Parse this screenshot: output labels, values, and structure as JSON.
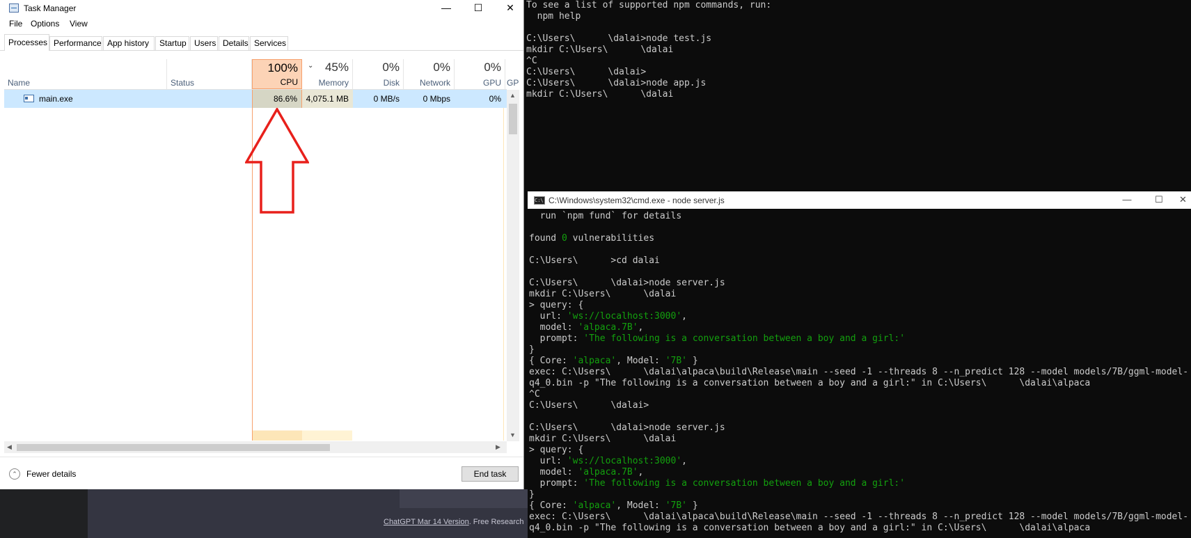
{
  "task_manager": {
    "title": "Task Manager",
    "window_buttons": {
      "minimize": "—",
      "maximize": "☐",
      "close": "✕"
    },
    "menu": [
      "File",
      "Options",
      "View"
    ],
    "tabs": [
      "Processes",
      "Performance",
      "App history",
      "Startup",
      "Users",
      "Details",
      "Services"
    ],
    "active_tab": "Processes",
    "columns": {
      "name": {
        "label": "Name"
      },
      "status": {
        "label": "Status"
      },
      "cpu": {
        "label": "CPU",
        "total": "100%"
      },
      "memory": {
        "label": "Memory",
        "total": "45%"
      },
      "disk": {
        "label": "Disk",
        "total": "0%"
      },
      "network": {
        "label": "Network",
        "total": "0%"
      },
      "gpu": {
        "label": "GPU",
        "total": "0%"
      },
      "gpu_engine": {
        "label": "GPU"
      }
    },
    "row": {
      "name": "main.exe",
      "status": "",
      "cpu": "86.6%",
      "memory": "4,075.1 MB",
      "disk": "0 MB/s",
      "network": "0 Mbps",
      "gpu": "0%"
    },
    "footer": {
      "fewer_details": "Fewer details",
      "end_task": "End task"
    }
  },
  "background_console": {
    "lines": [
      "To see a list of supported npm commands, run:",
      "  npm help",
      "",
      "C:\\Users\\      \\dalai>node test.js",
      "mkdir C:\\Users\\      \\dalai",
      "^C",
      "C:\\Users\\      \\dalai>",
      "C:\\Users\\      \\dalai>node app.js",
      "mkdir C:\\Users\\      \\dalai"
    ]
  },
  "cmd_window": {
    "title": "C:\\Windows\\system32\\cmd.exe - node  server.js",
    "window_buttons": {
      "minimize": "—",
      "maximize": "☐",
      "close": "✕"
    },
    "lines": [
      {
        "segments": [
          {
            "t": "  run `npm fund` for details"
          }
        ]
      },
      {
        "segments": [
          {
            "t": ""
          }
        ]
      },
      {
        "segments": [
          {
            "t": "found "
          },
          {
            "t": "0",
            "c": "g"
          },
          {
            "t": " vulnerabilities"
          }
        ]
      },
      {
        "segments": [
          {
            "t": ""
          }
        ]
      },
      {
        "segments": [
          {
            "t": "C:\\Users\\      >cd dalai"
          }
        ]
      },
      {
        "segments": [
          {
            "t": ""
          }
        ]
      },
      {
        "segments": [
          {
            "t": "C:\\Users\\      \\dalai>node server.js"
          }
        ]
      },
      {
        "segments": [
          {
            "t": "mkdir C:\\Users\\      \\dalai"
          }
        ]
      },
      {
        "segments": [
          {
            "t": "> query: {"
          }
        ]
      },
      {
        "segments": [
          {
            "t": "  url: "
          },
          {
            "t": "'ws://localhost:3000'",
            "c": "g"
          },
          {
            "t": ","
          }
        ]
      },
      {
        "segments": [
          {
            "t": "  model: "
          },
          {
            "t": "'alpaca.7B'",
            "c": "g"
          },
          {
            "t": ","
          }
        ]
      },
      {
        "segments": [
          {
            "t": "  prompt: "
          },
          {
            "t": "'The following is a conversation between a boy and a girl:'",
            "c": "g"
          }
        ]
      },
      {
        "segments": [
          {
            "t": "}"
          }
        ]
      },
      {
        "segments": [
          {
            "t": "{ Core: "
          },
          {
            "t": "'alpaca'",
            "c": "g"
          },
          {
            "t": ", Model: "
          },
          {
            "t": "'7B'",
            "c": "g"
          },
          {
            "t": " }"
          }
        ]
      },
      {
        "segments": [
          {
            "t": "exec: C:\\Users\\      \\dalai\\alpaca\\build\\Release\\main --seed -1 --threads 8 --n_predict 128 --model models/7B/ggml-model-"
          }
        ]
      },
      {
        "segments": [
          {
            "t": "q4_0.bin -p \"The following is a conversation between a boy and a girl:\" in C:\\Users\\      \\dalai\\alpaca"
          }
        ]
      },
      {
        "segments": [
          {
            "t": "^C"
          }
        ]
      },
      {
        "segments": [
          {
            "t": "C:\\Users\\      \\dalai>"
          }
        ]
      },
      {
        "segments": [
          {
            "t": ""
          }
        ]
      },
      {
        "segments": [
          {
            "t": "C:\\Users\\      \\dalai>node server.js"
          }
        ]
      },
      {
        "segments": [
          {
            "t": "mkdir C:\\Users\\      \\dalai"
          }
        ]
      },
      {
        "segments": [
          {
            "t": "> query: {"
          }
        ]
      },
      {
        "segments": [
          {
            "t": "  url: "
          },
          {
            "t": "'ws://localhost:3000'",
            "c": "g"
          },
          {
            "t": ","
          }
        ]
      },
      {
        "segments": [
          {
            "t": "  model: "
          },
          {
            "t": "'alpaca.7B'",
            "c": "g"
          },
          {
            "t": ","
          }
        ]
      },
      {
        "segments": [
          {
            "t": "  prompt: "
          },
          {
            "t": "'The following is a conversation between a boy and a girl:'",
            "c": "g"
          }
        ]
      },
      {
        "segments": [
          {
            "t": "}"
          }
        ]
      },
      {
        "segments": [
          {
            "t": "{ Core: "
          },
          {
            "t": "'alpaca'",
            "c": "g"
          },
          {
            "t": ", Model: "
          },
          {
            "t": "'7B'",
            "c": "g"
          },
          {
            "t": " }"
          }
        ]
      },
      {
        "segments": [
          {
            "t": "exec: C:\\Users\\      \\dalai\\alpaca\\build\\Release\\main --seed -1 --threads 8 --n_predict 128 --model models/7B/ggml-model-"
          }
        ]
      },
      {
        "segments": [
          {
            "t": "q4_0.bin -p \"The following is a conversation between a boy and a girl:\" in C:\\Users\\      \\dalai\\alpaca"
          }
        ]
      }
    ]
  },
  "chatgpt_footer": {
    "version_link": "ChatGPT Mar 14 Version",
    "rest": ". Free Research"
  },
  "colors": {
    "accent_green": "#13a10e",
    "cpu_highlight": "#fcd3b6",
    "selection": "#cce8ff",
    "annotation_red": "#e8201b"
  }
}
